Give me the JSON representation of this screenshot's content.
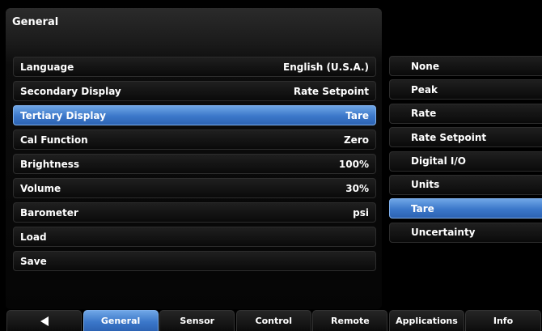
{
  "panel": {
    "title": "General"
  },
  "settings": [
    {
      "label": "Language",
      "value": "English (U.S.A.)"
    },
    {
      "label": "Secondary Display",
      "value": "Rate Setpoint"
    },
    {
      "label": "Tertiary Display",
      "value": "Tare"
    },
    {
      "label": "Cal Function",
      "value": "Zero"
    },
    {
      "label": "Brightness",
      "value": "100%"
    },
    {
      "label": "Volume",
      "value": "30%"
    },
    {
      "label": "Barometer",
      "value": "psi"
    },
    {
      "label": "Load",
      "value": ""
    },
    {
      "label": "Save",
      "value": ""
    }
  ],
  "options": [
    "None",
    "Peak",
    "Rate",
    "Rate Setpoint",
    "Digital I/O",
    "Units",
    "Tare",
    "Uncertainty"
  ],
  "tabs": [
    "General",
    "Sensor",
    "Control",
    "Remote",
    "Applications",
    "Info"
  ],
  "back_icon": "left-arrow-icon",
  "colors": {
    "accent": "#3b77c9",
    "background": "#000000"
  }
}
